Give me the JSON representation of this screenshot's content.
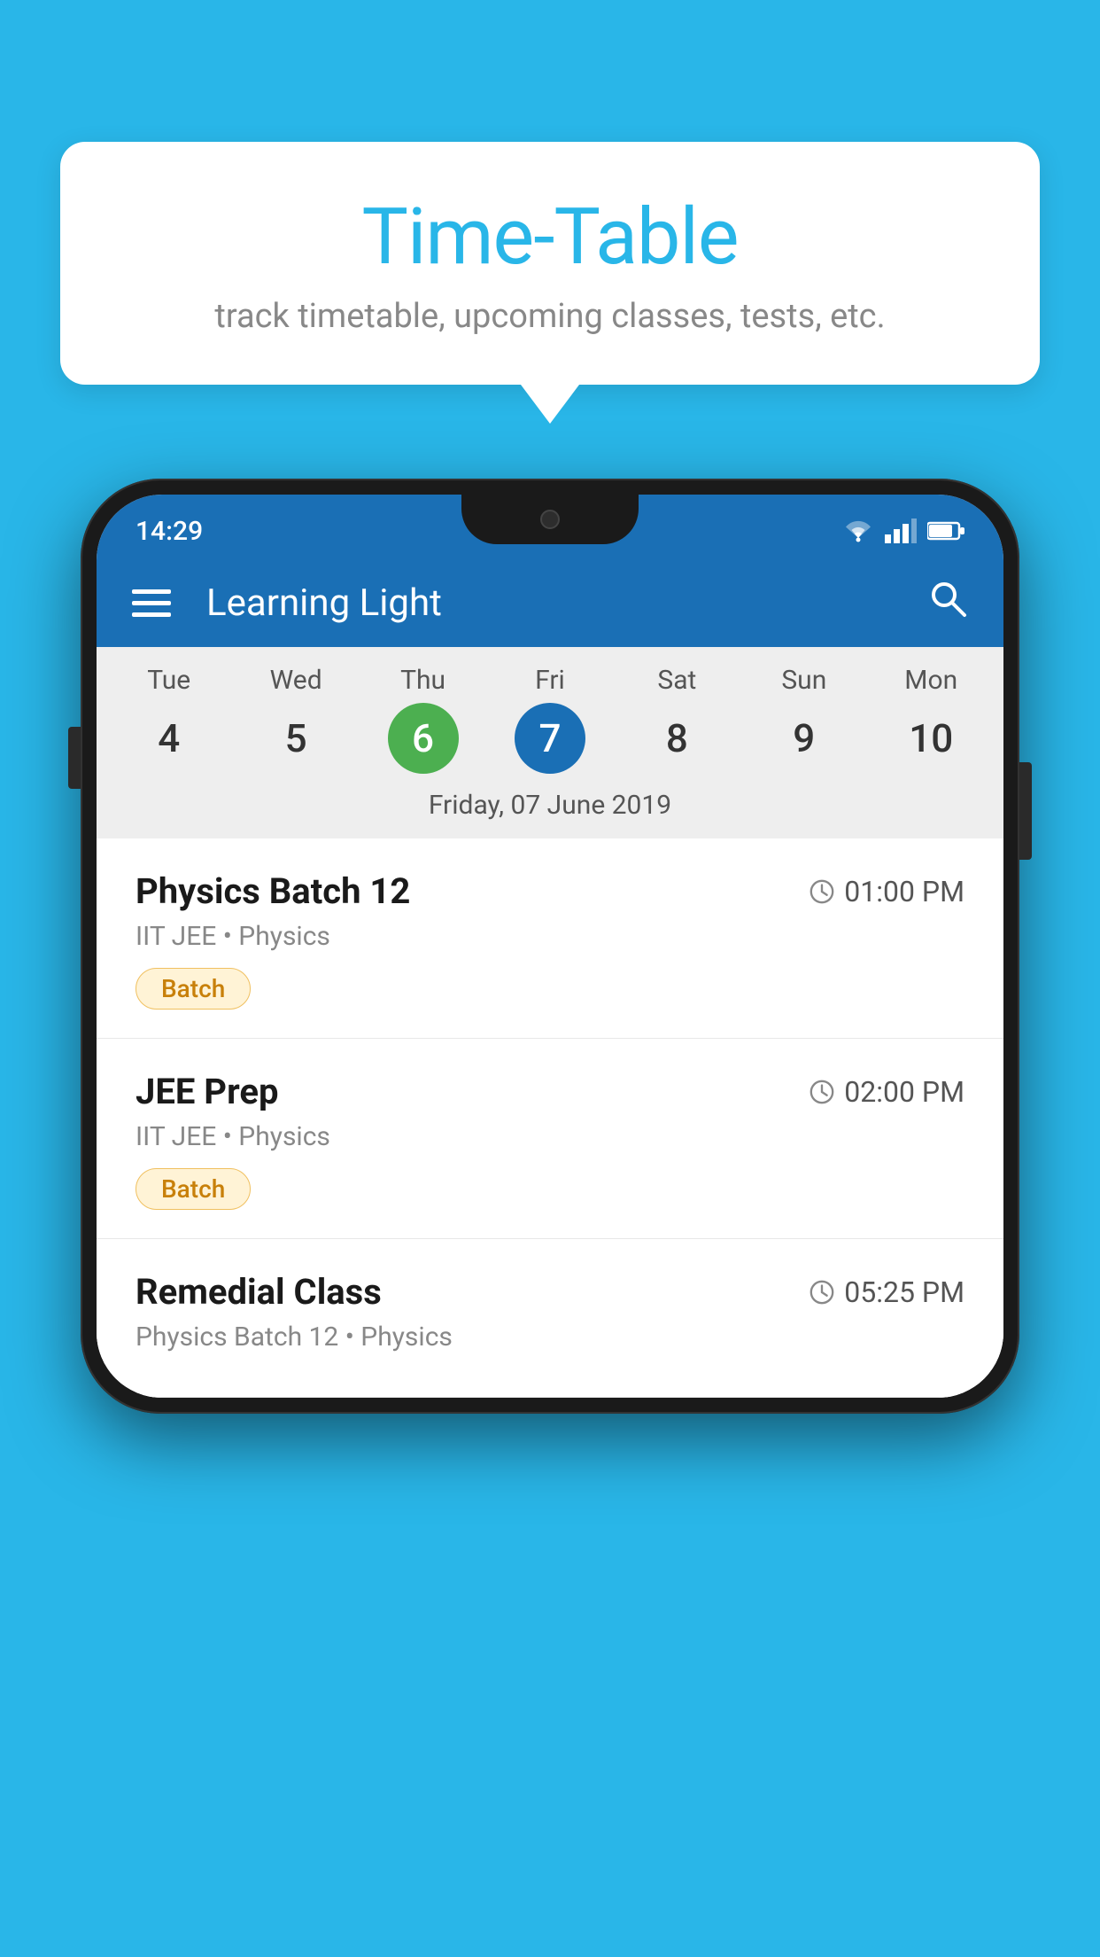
{
  "background_color": "#29b6e8",
  "bubble": {
    "title": "Time-Table",
    "subtitle": "track timetable, upcoming classes, tests, etc."
  },
  "status_bar": {
    "time": "14:29"
  },
  "app_bar": {
    "title": "Learning Light",
    "hamburger_label": "menu",
    "search_label": "search"
  },
  "calendar": {
    "days": [
      {
        "label": "Tue",
        "number": "4",
        "state": "normal"
      },
      {
        "label": "Wed",
        "number": "5",
        "state": "normal"
      },
      {
        "label": "Thu",
        "number": "6",
        "state": "today"
      },
      {
        "label": "Fri",
        "number": "7",
        "state": "selected"
      },
      {
        "label": "Sat",
        "number": "8",
        "state": "normal"
      },
      {
        "label": "Sun",
        "number": "9",
        "state": "normal"
      },
      {
        "label": "Mon",
        "number": "10",
        "state": "normal"
      }
    ],
    "selected_date_label": "Friday, 07 June 2019"
  },
  "schedule": {
    "items": [
      {
        "title": "Physics Batch 12",
        "time": "01:00 PM",
        "subtitle": "IIT JEE • Physics",
        "badge": "Batch"
      },
      {
        "title": "JEE Prep",
        "time": "02:00 PM",
        "subtitle": "IIT JEE • Physics",
        "badge": "Batch"
      },
      {
        "title": "Remedial Class",
        "time": "05:25 PM",
        "subtitle": "Physics Batch 12 • Physics",
        "badge": ""
      }
    ]
  }
}
